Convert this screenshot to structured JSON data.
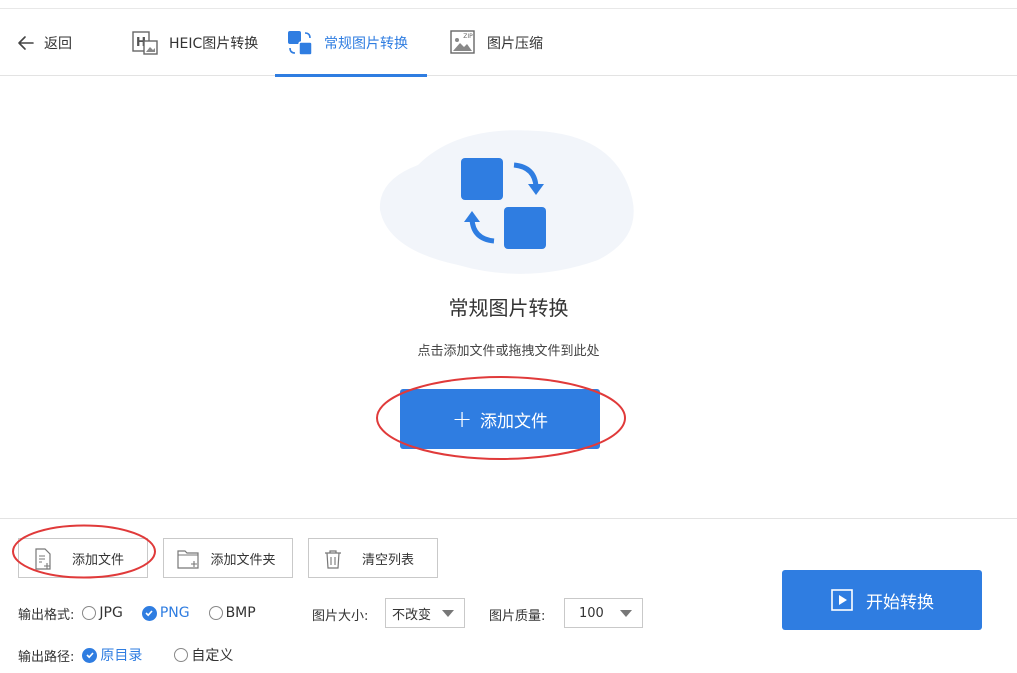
{
  "header": {
    "back_label": "返回",
    "tabs": [
      {
        "label": "HEIC图片转换",
        "icon": "heic-icon",
        "active": false
      },
      {
        "label": "常规图片转换",
        "icon": "image-convert-icon",
        "active": true
      },
      {
        "label": "图片压缩",
        "icon": "zip-image-icon",
        "active": false
      }
    ]
  },
  "main": {
    "title": "常规图片转换",
    "subtitle": "点击添加文件或拖拽文件到此处",
    "add_button": "添加文件"
  },
  "toolbar": {
    "add_file": "添加文件",
    "add_folder": "添加文件夹",
    "clear_list": "清空列表"
  },
  "settings": {
    "format_label": "输出格式:",
    "formats": [
      {
        "label": "JPG",
        "selected": false
      },
      {
        "label": "PNG",
        "selected": true
      },
      {
        "label": "BMP",
        "selected": false
      }
    ],
    "size_label": "图片大小:",
    "size_value": "不改变",
    "quality_label": "图片质量:",
    "quality_value": "100",
    "path_label": "输出路径:",
    "paths": [
      {
        "label": "原目录",
        "selected": true
      },
      {
        "label": "自定义",
        "selected": false
      }
    ]
  },
  "start_button": "开始转换",
  "colors": {
    "accent": "#2f7de1",
    "annotation": "#e03a3a"
  }
}
